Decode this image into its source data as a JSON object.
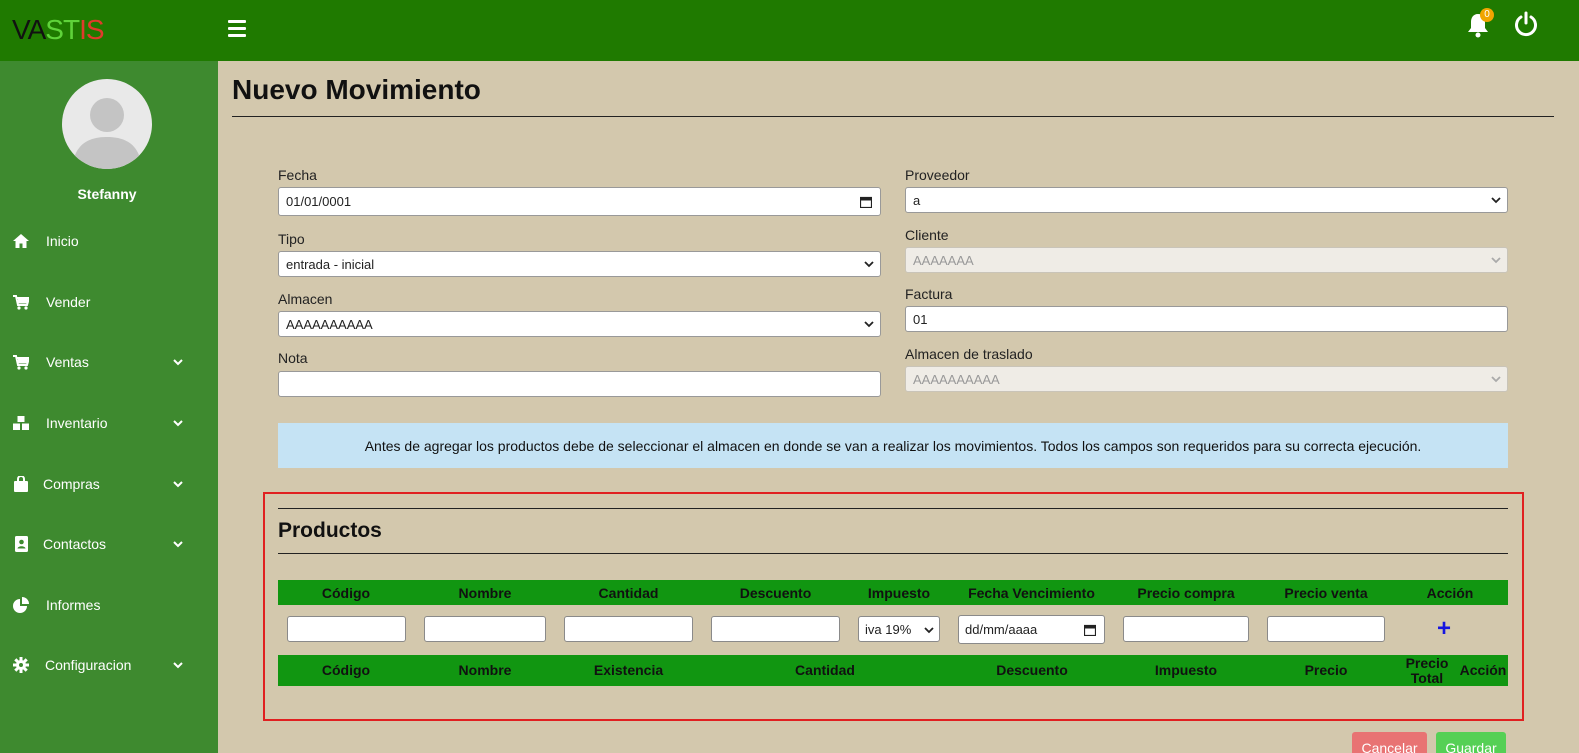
{
  "header": {
    "logo": [
      "VA",
      "ST",
      "IS"
    ],
    "notification_count": "0"
  },
  "sidebar": {
    "username": "Stefanny",
    "items": [
      {
        "label": "Inicio",
        "icon": "home-icon"
      },
      {
        "label": "Vender",
        "icon": "cart-icon"
      },
      {
        "label": "Ventas",
        "icon": "cart-icon",
        "has_submenu": true
      },
      {
        "label": "Inventario",
        "icon": "boxes-icon",
        "has_submenu": true
      },
      {
        "label": "Compras",
        "icon": "shopping-bag-icon",
        "has_submenu": true
      },
      {
        "label": "Contactos",
        "icon": "address-book-icon",
        "has_submenu": true
      },
      {
        "label": "Informes",
        "icon": "pie-chart-icon"
      },
      {
        "label": "Configuracion",
        "icon": "gear-icon",
        "has_submenu": true
      }
    ]
  },
  "main": {
    "title": "Nuevo Movimiento",
    "form": {
      "fecha": {
        "label": "Fecha",
        "value": "01/01/0001"
      },
      "tipo": {
        "label": "Tipo",
        "value": "entrada - inicial"
      },
      "almacen": {
        "label": "Almacen",
        "value": "AAAAAAAAAA"
      },
      "nota": {
        "label": "Nota",
        "value": ""
      },
      "proveedor": {
        "label": "Proveedor",
        "value": "a"
      },
      "cliente": {
        "label": "Cliente",
        "value": "AAAAAAA"
      },
      "factura": {
        "label": "Factura",
        "value": "01"
      },
      "almacen_traslado": {
        "label": "Almacen de traslado",
        "value": "AAAAAAAAAA"
      }
    },
    "info": "Antes de agregar los productos debe de seleccionar el almacen en donde se van a realizar los movimientos. Todos los campos son requeridos para su correcta ejecución.",
    "productos": {
      "title": "Productos",
      "entry_headers": [
        "Código",
        "Nombre",
        "Cantidad",
        "Descuento",
        "Impuesto",
        "Fecha Vencimiento",
        "Precio compra",
        "Precio venta",
        "Acción"
      ],
      "impuesto_value": "iva 19%",
      "fecha_placeholder": "dd/mm/aaaa",
      "add_label": "+",
      "list_headers": [
        "Código",
        "Nombre",
        "Existencia",
        "Cantidad",
        "Descuento",
        "Impuesto",
        "Precio",
        "Precio Total",
        "Acción"
      ]
    },
    "buttons": {
      "cancel": "Cancelar",
      "save": "Guardar"
    }
  }
}
